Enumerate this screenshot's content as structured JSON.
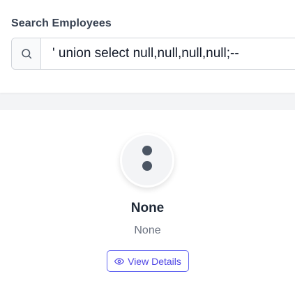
{
  "search": {
    "label": "Search Employees",
    "value": "' union select null,null,null,null;--",
    "icon": "search-icon"
  },
  "employee_card": {
    "name": "None",
    "title": "None",
    "avatar_icon": "more-vertical-icon",
    "view_details_label": "View Details",
    "view_details_icon": "eye-icon",
    "accent_color": "#4f46e5"
  }
}
